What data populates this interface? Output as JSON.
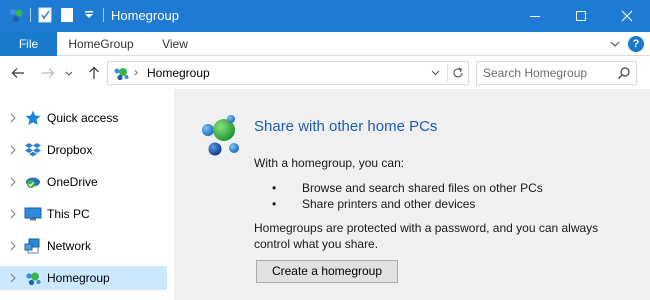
{
  "window": {
    "title": "Homegroup",
    "accent_color": "#1e7ad3",
    "controls": [
      "minimize-icon",
      "maximize-icon",
      "close-icon"
    ]
  },
  "quick_access_toolbar": {
    "icons": [
      "homegroup-icon",
      "properties-icon",
      "new-folder-icon",
      "customize-dropdown-icon"
    ]
  },
  "ribbon": {
    "tabs": [
      {
        "label": "File",
        "active": true
      },
      {
        "label": "HomeGroup"
      },
      {
        "label": "View"
      }
    ],
    "help": "?"
  },
  "address_bar": {
    "location": "Homegroup",
    "location_icon": "homegroup-icon"
  },
  "search": {
    "placeholder": "Search Homegroup"
  },
  "nav_pane": {
    "items": [
      {
        "label": "Quick access",
        "icon": "star-icon"
      },
      {
        "label": "Dropbox",
        "icon": "dropbox-icon"
      },
      {
        "label": "OneDrive",
        "icon": "onedrive-icon"
      },
      {
        "label": "This PC",
        "icon": "computer-icon"
      },
      {
        "label": "Network",
        "icon": "network-icon"
      },
      {
        "label": "Homegroup",
        "icon": "homegroup-icon",
        "selected": true
      }
    ]
  },
  "content": {
    "title": "Share with other home PCs",
    "intro": "With a homegroup, you can:",
    "bullets": [
      "Browse and search shared files on other PCs",
      "Share printers and other devices"
    ],
    "paragraph_line1": "Homegroups are protected with a password, and you can always",
    "paragraph_line2": "control what you share.",
    "create_button": "Create a homegroup"
  }
}
